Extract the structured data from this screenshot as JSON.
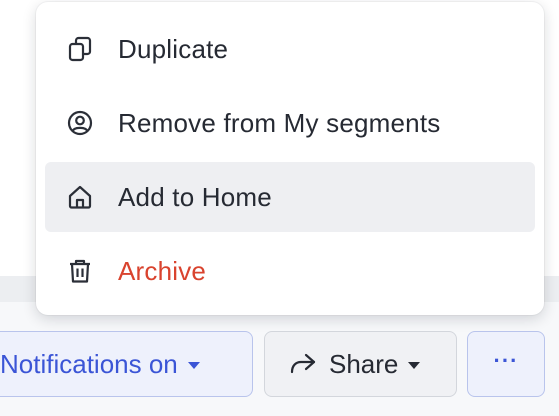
{
  "menu": {
    "items": [
      {
        "label": "Duplicate",
        "icon": "copy-icon"
      },
      {
        "label": "Remove from My segments",
        "icon": "user-circle-icon"
      },
      {
        "label": "Add to Home",
        "icon": "home-icon",
        "highlighted": true
      },
      {
        "label": "Archive",
        "icon": "trash-icon",
        "danger": true
      }
    ]
  },
  "toolbar": {
    "notifications_label": "Notifications on",
    "share_label": "Share",
    "more_label": "···"
  },
  "colors": {
    "danger": "#d9432e",
    "accent": "#3b55d6",
    "highlight_bg": "#eeeff2"
  }
}
